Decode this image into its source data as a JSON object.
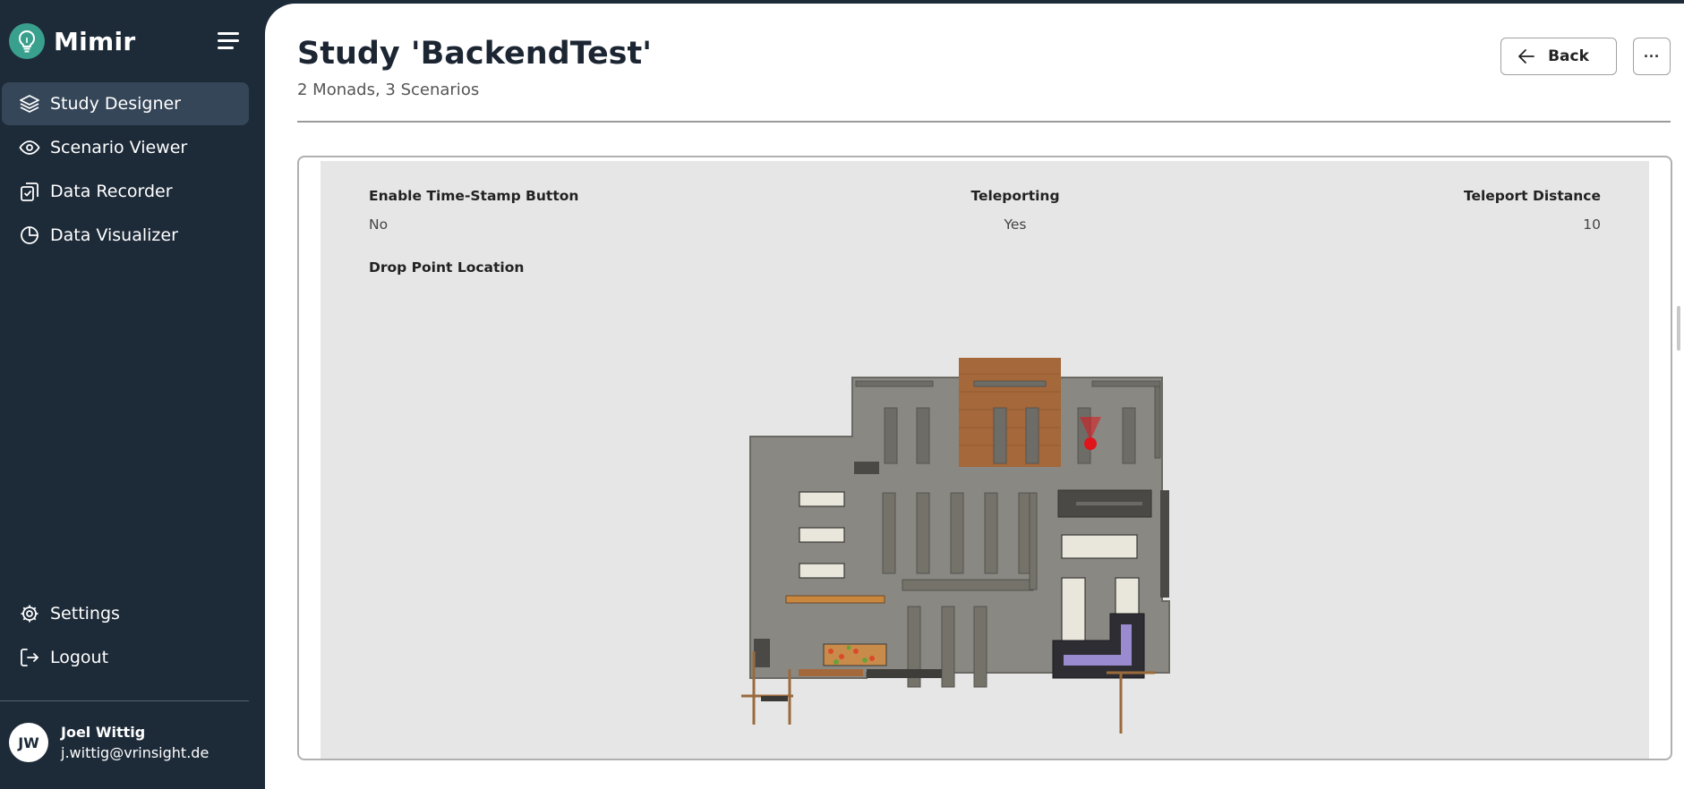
{
  "app": {
    "name": "Mimir"
  },
  "sidebar": {
    "items": [
      {
        "label": "Study Designer",
        "icon": "layers-icon",
        "active": true
      },
      {
        "label": "Scenario Viewer",
        "icon": "eye-icon",
        "active": false
      },
      {
        "label": "Data Recorder",
        "icon": "clipboard-check-icon",
        "active": false
      },
      {
        "label": "Data Visualizer",
        "icon": "pie-chart-icon",
        "active": false
      }
    ],
    "bottom": [
      {
        "label": "Settings",
        "icon": "gear-icon"
      },
      {
        "label": "Logout",
        "icon": "logout-icon"
      }
    ],
    "user": {
      "initials": "JW",
      "name": "Joel Wittig",
      "email": "j.wittig@vrinsight.de"
    }
  },
  "header": {
    "title": "Study 'BackendTest'",
    "subtitle": "2 Monads, 3 Scenarios",
    "back_label": "Back",
    "more_label": "···"
  },
  "settings": {
    "timestamp": {
      "label": "Enable Time-Stamp Button",
      "value": "No"
    },
    "teleporting": {
      "label": "Teleporting",
      "value": "Yes"
    },
    "teleport_distance": {
      "label": "Teleport Distance",
      "value": "10"
    },
    "drop_point": {
      "label": "Drop Point Location"
    }
  },
  "colors": {
    "sidebar": "#1d2a38",
    "active": "#354658",
    "accent": "#3aa08e",
    "drop_point": "#e0141b"
  }
}
